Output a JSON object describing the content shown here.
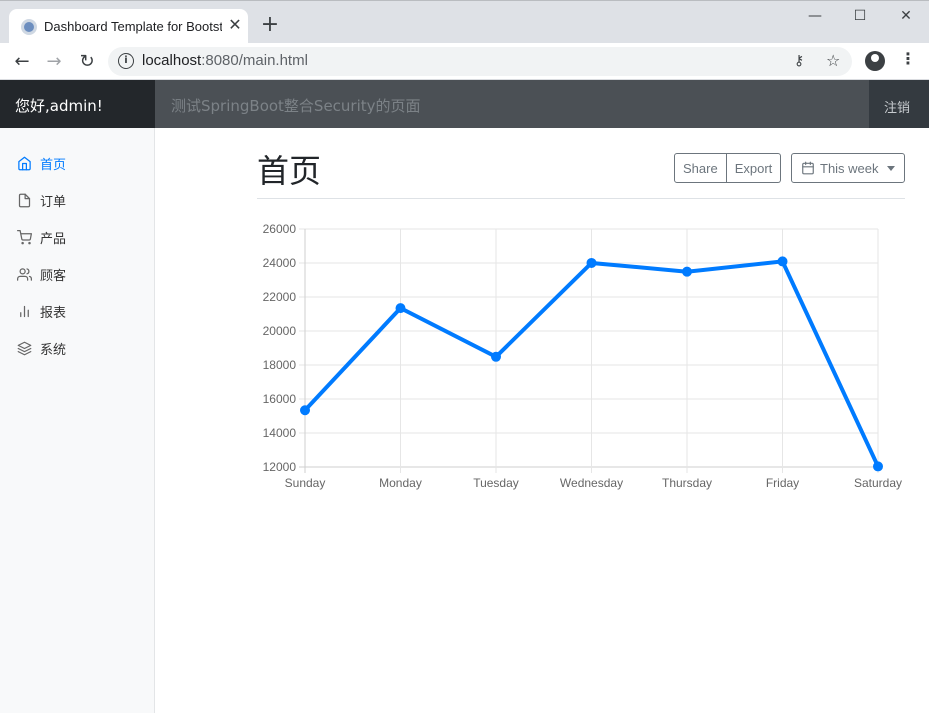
{
  "browser": {
    "tab_title": "Dashboard Template for Bootstrap",
    "url_host": "localhost",
    "url_rest": ":8080/main.html"
  },
  "navbar": {
    "brand": "您好,admin!",
    "search_placeholder": "测试SpringBoot整合Security的页面",
    "signout": "注销"
  },
  "sidebar": {
    "items": [
      {
        "label": "首页",
        "icon": "home-icon",
        "active": true
      },
      {
        "label": "订单",
        "icon": "file-icon",
        "active": false
      },
      {
        "label": "产品",
        "icon": "shopping-cart-icon",
        "active": false
      },
      {
        "label": "顾客",
        "icon": "users-icon",
        "active": false
      },
      {
        "label": "报表",
        "icon": "bar-chart-icon",
        "active": false
      },
      {
        "label": "系统",
        "icon": "layers-icon",
        "active": false
      }
    ]
  },
  "main": {
    "title": "首页",
    "share_label": "Share",
    "export_label": "Export",
    "week_label": "This week"
  },
  "colors": {
    "accent": "#007bff",
    "line": "#007bff"
  },
  "chart_data": {
    "type": "line",
    "categories": [
      "Sunday",
      "Monday",
      "Tuesday",
      "Wednesday",
      "Thursday",
      "Friday",
      "Saturday"
    ],
    "values": [
      15339,
      21345,
      18483,
      24003,
      23489,
      24092,
      12034
    ],
    "ylim": [
      12000,
      26000
    ],
    "yticks": [
      12000,
      14000,
      16000,
      18000,
      20000,
      22000,
      24000,
      26000
    ],
    "grid": true
  }
}
